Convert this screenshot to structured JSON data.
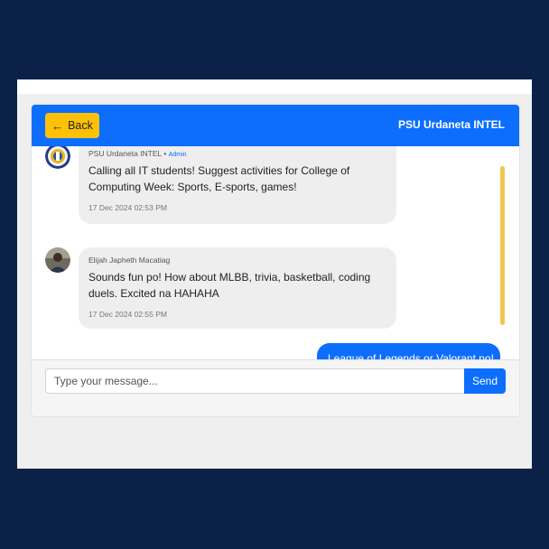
{
  "header": {
    "back_label": "Back",
    "title": "PSU Urdaneta INTEL"
  },
  "messages": [
    {
      "sender": "PSU Urdaneta INTEL",
      "role": "Admin",
      "text": "Calling all IT students! Suggest activities for College of Computing Week: Sports, E-sports, games!",
      "time": "17 Dec 2024 02:53 PM",
      "avatar_icon": "psu-logo-icon"
    },
    {
      "sender": "Elijah Japheth Macatiag",
      "text": "Sounds fun po! How about MLBB, trivia, basketball, coding duels. Excited na HAHAHA",
      "time": "17 Dec 2024 02:55 PM",
      "avatar_icon": "user-photo-icon"
    }
  ],
  "own_message": {
    "text": "League of Legends or Valorant po!"
  },
  "composer": {
    "placeholder": "Type your message...",
    "send_label": "Send"
  },
  "colors": {
    "background": "#0b2148",
    "header": "#0d6efd",
    "back_button": "#ffc107",
    "scrollbar": "#f3c64f",
    "own_bubble": "#0d6efd"
  }
}
